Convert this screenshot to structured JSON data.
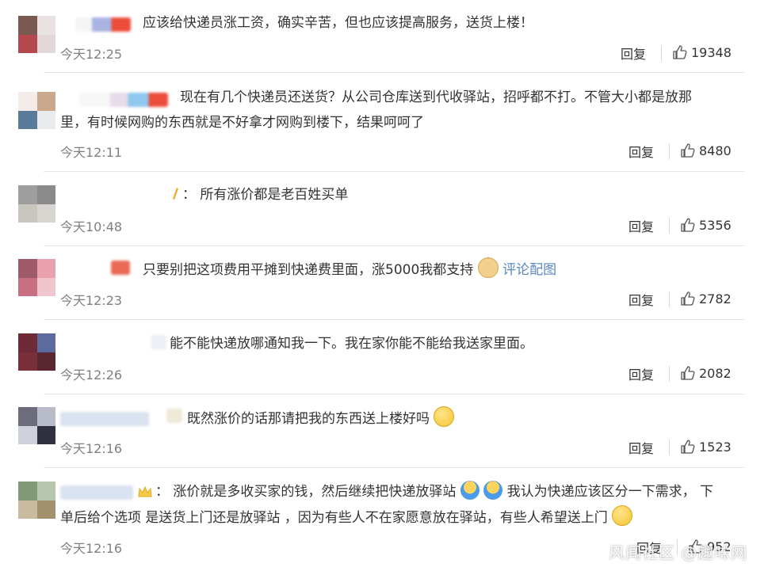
{
  "comments": [
    {
      "text": "应该给快递员涨工资，确实辛苦，但也应该提高服务，送货上楼！",
      "time": "今天12:25",
      "reply_label": "回复",
      "likes": "19348"
    },
    {
      "text": "现在有几个快递员还送货？从公司仓库送到代收驿站，招呼都不打。不管大小都是放那",
      "text2": "里，有时候网购的东西就是不好拿才网购到楼下，结果呵呵了",
      "time": "今天12:11",
      "reply_label": "回复",
      "likes": "8480"
    },
    {
      "prefix": "：",
      "text": "所有涨价都是老百姓买单",
      "time": "今天10:48",
      "reply_label": "回复",
      "likes": "5356"
    },
    {
      "text": "只要别把这项费用平摊到快递费里面，涨5000我都支持",
      "link": "评论配图",
      "time": "今天12:23",
      "reply_label": "回复",
      "likes": "2782"
    },
    {
      "text": "能不能快递放哪通知我一下。我在家你能不能给我送家里面。",
      "time": "今天12:26",
      "reply_label": "回复",
      "likes": "2082"
    },
    {
      "text": "既然涨价的话那请把我的东西送上楼好吗",
      "time": "今天12:16",
      "reply_label": "回复",
      "likes": "1523"
    },
    {
      "prefix": "：",
      "text": "涨价就是多收买家的钱，然后继续把快递放驿站",
      "text_b": "我认为快递应该区分一下需求，  下",
      "text2": "单后给个选项 是送货上门还是放驿站 ，因为有些人不在家愿意放在驿站，有些人希望送上门",
      "time": "今天12:16",
      "reply_label": "回复",
      "likes": "952"
    }
  ],
  "watermark": "风闻社区 @趣味网",
  "colors": {
    "text": "#333333",
    "time": "#808080",
    "link": "#5b87c3",
    "divider": "#e6e6e6"
  },
  "icons": {
    "like": "thumbs-up-icon",
    "smile": "smile-emoji-icon",
    "doge": "doge-emoji-icon",
    "shrug": "shrug-emoji-icon"
  }
}
